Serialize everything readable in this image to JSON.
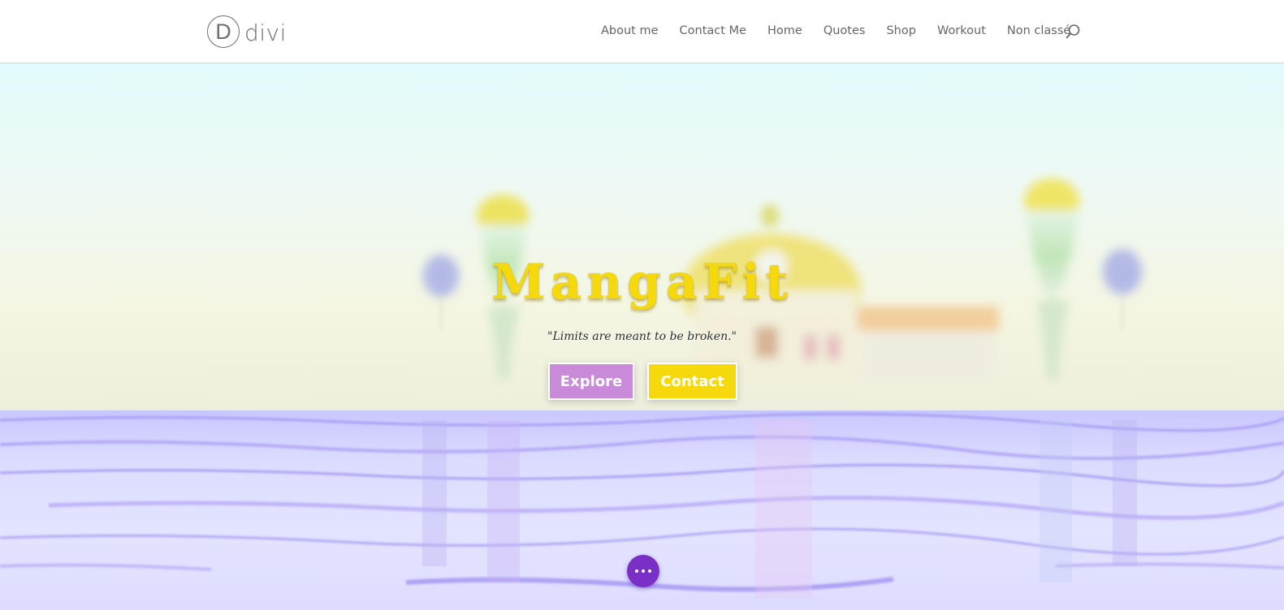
{
  "header": {
    "logo_mark": "D",
    "logo_text": "divi",
    "nav": [
      {
        "label": "About me"
      },
      {
        "label": "Contact Me"
      },
      {
        "label": "Home"
      },
      {
        "label": "Quotes"
      },
      {
        "label": "Shop"
      },
      {
        "label": "Workout"
      },
      {
        "label": "Non classé"
      }
    ],
    "search_icon": "search-icon"
  },
  "hero": {
    "title": "MangaFit",
    "subtitle": "\"Limits are meant to be broken.\"",
    "buttons": [
      {
        "label": "Explore",
        "color": "#c88ad9"
      },
      {
        "label": "Contact",
        "color": "#f6d90c"
      }
    ],
    "more_icon": "more-horizontal-icon",
    "accent_color": "#7a2fc6",
    "title_color": "#f6d90c"
  }
}
